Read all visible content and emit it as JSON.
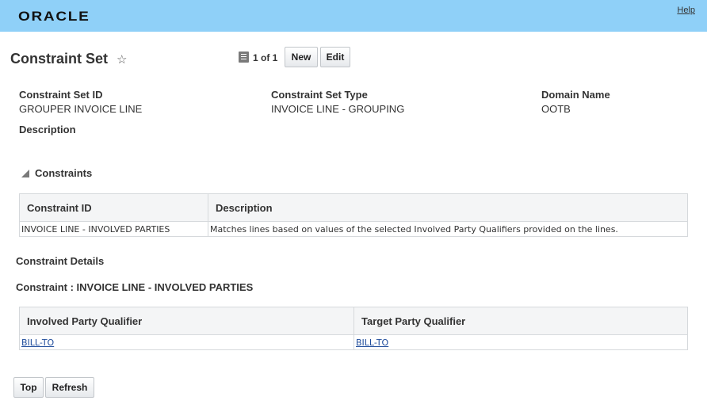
{
  "header": {
    "brand": "ORACLE",
    "help": "Help"
  },
  "page": {
    "title": "Constraint Set",
    "record_count": "1 of 1",
    "new_label": "New",
    "edit_label": "Edit"
  },
  "fields": {
    "constraint_set_id": {
      "label": "Constraint Set ID",
      "value": "GROUPER INVOICE LINE"
    },
    "constraint_set_type": {
      "label": "Constraint Set Type",
      "value": "INVOICE LINE - GROUPING"
    },
    "domain_name": {
      "label": "Domain Name",
      "value": "OOTB"
    },
    "description": {
      "label": "Description",
      "value": ""
    }
  },
  "constraints": {
    "title": "Constraints",
    "columns": [
      "Constraint ID",
      "Description"
    ],
    "rows": [
      [
        "INVOICE LINE - INVOLVED PARTIES",
        "Matches lines based on values of the selected Involved Party Qualifiers provided on the lines."
      ]
    ]
  },
  "details": {
    "title": "Constraint Details",
    "subtitle": "Constraint : INVOICE LINE - INVOLVED PARTIES",
    "columns": [
      "Involved Party Qualifier",
      "Target Party Qualifier"
    ],
    "rows": [
      [
        "BILL-TO",
        "BILL-TO"
      ]
    ]
  },
  "footer": {
    "top_label": "Top",
    "refresh_label": "Refresh"
  }
}
